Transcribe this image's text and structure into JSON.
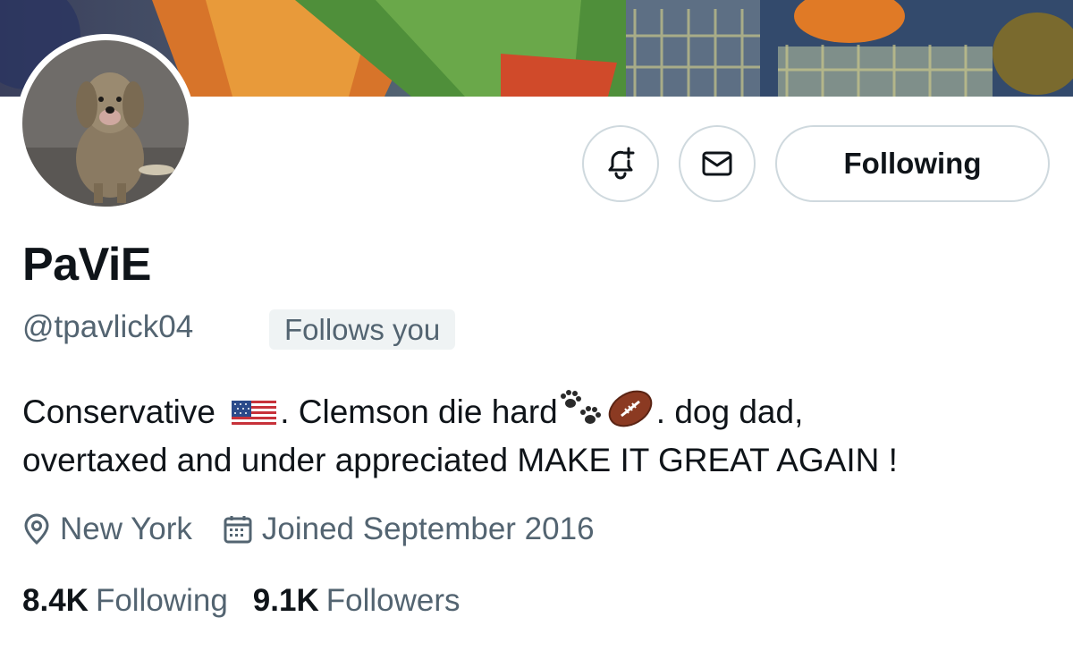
{
  "profile": {
    "display_name": "PaViE",
    "handle": "@tpavlick04",
    "follows_you_badge": "Follows you",
    "avatar_icon": "dog-avatar-icon",
    "banner_icon": "stadium-banner-image"
  },
  "actions": {
    "notify_icon": "bell-plus-icon",
    "message_icon": "envelope-icon",
    "following_label": "Following"
  },
  "bio": {
    "part1": "Conservative ",
    "part2": ". Clemson die hard",
    "part3": ". dog dad,",
    "line2": "overtaxed and under appreciated MAKE IT GREAT AGAIN !",
    "emoji": [
      "us-flag-emoji",
      "paw-prints-emoji",
      "american-football-emoji"
    ]
  },
  "meta": {
    "location": "New York",
    "joined": "Joined September 2016",
    "location_icon": "location-pin-icon",
    "joined_icon": "calendar-icon"
  },
  "stats": {
    "following_count": "8.4K",
    "following_label": "Following",
    "followers_count": "9.1K",
    "followers_label": "Followers"
  },
  "colors": {
    "text_primary": "#0f1419",
    "text_secondary": "#536471",
    "border": "#cfd9de",
    "badge_bg": "#eff3f4"
  }
}
